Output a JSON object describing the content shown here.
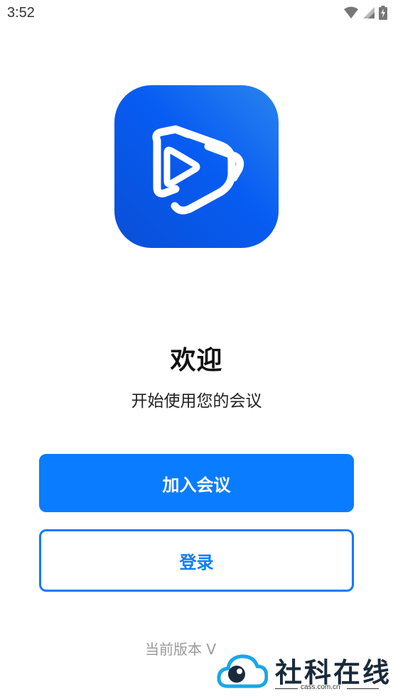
{
  "status_bar": {
    "time": "3:52",
    "icons": [
      "wifi-icon",
      "signal-icon",
      "battery-charging-icon"
    ]
  },
  "app": {
    "icon_name": "play-logo-icon",
    "brand_gradient": [
      "#0a4fd6",
      "#1e7cf0"
    ]
  },
  "welcome": {
    "title": "欢迎",
    "subtitle": "开始使用您的会议"
  },
  "buttons": {
    "join_label": "加入会议",
    "login_label": "登录"
  },
  "version": {
    "text": "当前版本 V"
  },
  "watermark": {
    "brand": "社科在线",
    "domain": "cass.com.cn"
  },
  "colors": {
    "accent": "#0a7cff",
    "text_primary": "#111111",
    "text_muted": "#9a9a9a"
  }
}
